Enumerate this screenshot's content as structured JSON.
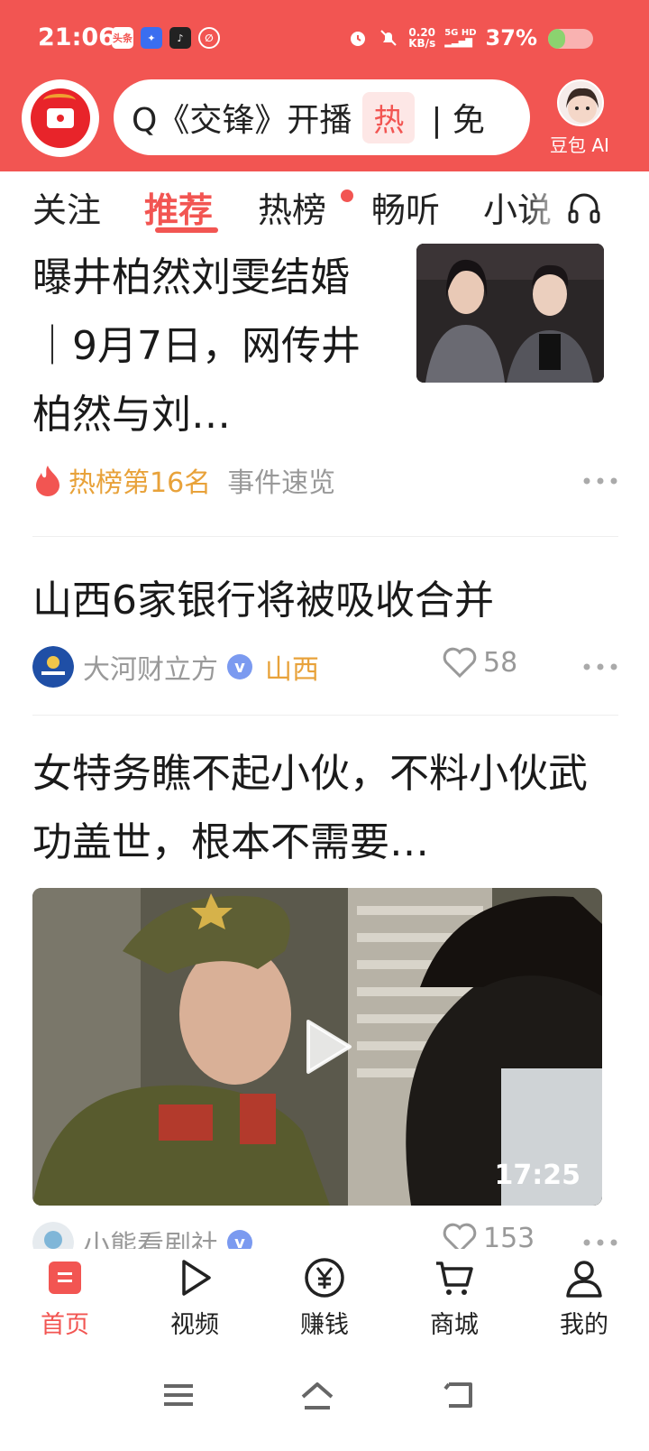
{
  "status_bar": {
    "time": "21:06",
    "apps": [
      "头条",
      "",
      "",
      ""
    ],
    "net_speed_value": "0.20",
    "net_speed_unit": "KB/s",
    "signal_top": "5G HD",
    "battery_text": "37%",
    "battery_level": 0.37
  },
  "header": {
    "search_text": "Q《交锋》开播",
    "search_hot": "热",
    "search_next": "| 免",
    "ai_label": "豆包 AI"
  },
  "tabs": [
    {
      "label": "关注"
    },
    {
      "label": "推荐"
    },
    {
      "label": "热榜"
    },
    {
      "label": "畅听"
    },
    {
      "label": "小说"
    }
  ],
  "feed": {
    "item1": {
      "title": "曝井柏然刘雯结婚｜9月7日，网传井柏然与刘…",
      "hot_rank": "热榜第16名",
      "tag": "事件速览"
    },
    "item2": {
      "title": "山西6家银行将被吸收合并",
      "source": "大河财立方",
      "verified_mark": "v",
      "region": "山西",
      "likes": "58"
    },
    "item3": {
      "title": "女特务瞧不起小伙，不料小伙武功盖世，根本不需要…",
      "duration": "17:25",
      "source": "小熊看剧社",
      "verified_mark": "v",
      "likes": "153"
    }
  },
  "bottom_nav": [
    {
      "label": "首页",
      "icon": "home-icon"
    },
    {
      "label": "视频",
      "icon": "play-icon"
    },
    {
      "label": "赚钱",
      "icon": "yuan-icon"
    },
    {
      "label": "商城",
      "icon": "cart-icon"
    },
    {
      "label": "我的",
      "icon": "user-icon"
    }
  ],
  "colors": {
    "brand_red": "#f25552",
    "hot_orange": "#e8a23a",
    "meta_gray": "#999999"
  }
}
